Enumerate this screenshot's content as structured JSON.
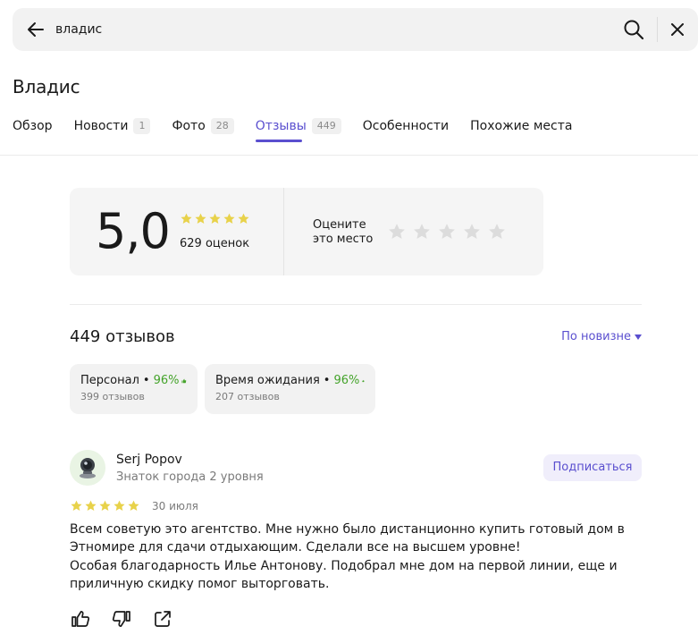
{
  "search": {
    "query": "владис"
  },
  "place": {
    "title": "Владис"
  },
  "tabs": [
    {
      "label": "Обзор",
      "count": ""
    },
    {
      "label": "Новости",
      "count": "1"
    },
    {
      "label": "Фото",
      "count": "28"
    },
    {
      "label": "Отзывы",
      "count": "449",
      "active": true
    },
    {
      "label": "Особенности",
      "count": ""
    },
    {
      "label": "Похожие места",
      "count": ""
    }
  ],
  "rating": {
    "score": "5,0",
    "stars": 5,
    "votes": "629 оценок",
    "rate_prompt": "Оцените\nэто место"
  },
  "reviews_header": {
    "count_label": "449 отзывов",
    "sort_label": "По новизне"
  },
  "aspects": [
    {
      "name": "Персонал",
      "percent": "96%",
      "reviews": "399 отзывов"
    },
    {
      "name": "Время ожидания",
      "percent": "96%",
      "reviews": "207 отзывов"
    }
  ],
  "review": {
    "author": "Serj Popov",
    "level": "Знаток города 2 уровня",
    "subscribe_label": "Подписаться",
    "stars": 5,
    "date": "30 июля",
    "text": "Всем советую это агентство. Мне нужно было дистанционно купить готовый дом в\nЭтномире для сдачи отдыхающим. Сделали все на высшем уровне!\nОсобая благодарность Илье Антонову. Подобрал мне дом на первой линии, еще и\nприличную скидку помог выторговать."
  },
  "colors": {
    "accent": "#5a4fcf",
    "star_filled": "#e8d24a",
    "star_empty": "#dcdcdc",
    "positive": "#44a32a"
  }
}
